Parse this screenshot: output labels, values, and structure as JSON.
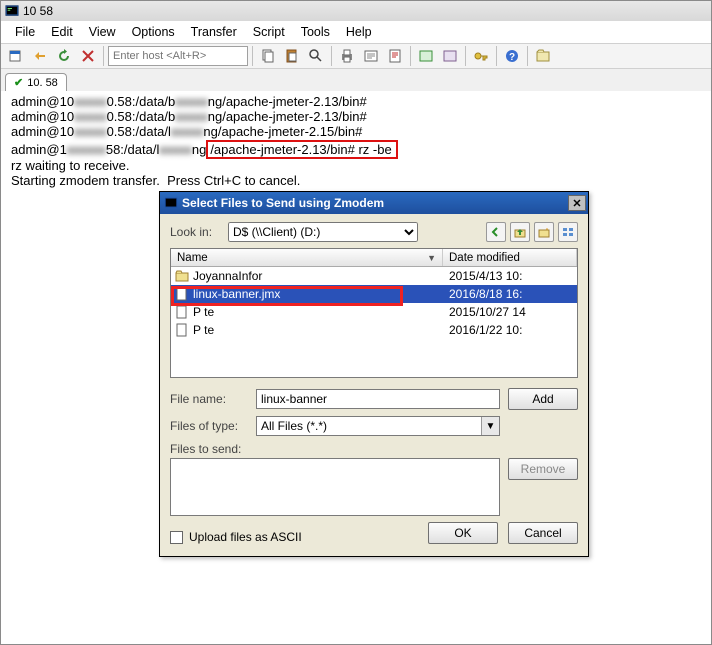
{
  "app": {
    "title": "10        58"
  },
  "menus": {
    "file": "File",
    "edit": "Edit",
    "view": "View",
    "options": "Options",
    "transfer": "Transfer",
    "script": "Script",
    "tools": "Tools",
    "help": "Help"
  },
  "hostbox": {
    "placeholder": "Enter host <Alt+R>"
  },
  "tab": {
    "label": "10.       58"
  },
  "term": {
    "l1a": "admin@10",
    "l1b": "0.58:/data/b",
    "l1c": "ng/apache-jmeter-2.13/bin#",
    "l2a": "admin@10",
    "l2b": "0.58:/data/b",
    "l2c": "ng/apache-jmeter-2.13/bin#",
    "l3a": "admin@10",
    "l3b": "0.58:/data/l",
    "l3c": "ng/apache-jmeter-2.15/bin#",
    "l4a": "admin@1",
    "l4b": "58:/data/l",
    "l4c": "ng",
    "l4d": "/apache-jmeter-2.13/bin# rz -be",
    "l5": "rz waiting to receive.",
    "l6": "Starting zmodem transfer.  Press Ctrl+C to cancel."
  },
  "dlg": {
    "title": "Select Files to Send using Zmodem",
    "look_in_label": "Look in:",
    "look_in_value": "D$ (\\\\Client) (D:)",
    "cols": {
      "name": "Name",
      "date": "Date modified"
    },
    "rows": [
      {
        "name": "JoyannaInfor",
        "date": "2015/4/13 10:"
      },
      {
        "name": "linux-banner.jmx",
        "date": "2016/8/18 16:"
      },
      {
        "name": "P        te",
        "date": "2015/10/27 14"
      },
      {
        "name": "P        te",
        "date": "2016/1/22 10:"
      }
    ],
    "file_name_label": "File name:",
    "file_name_value": "linux-banner",
    "types_label": "Files of type:",
    "types_value": "All Files (*.*)",
    "send_label": "Files to send:",
    "add": "Add",
    "remove": "Remove",
    "ascii": "Upload files as ASCII",
    "ok": "OK",
    "cancel": "Cancel"
  }
}
